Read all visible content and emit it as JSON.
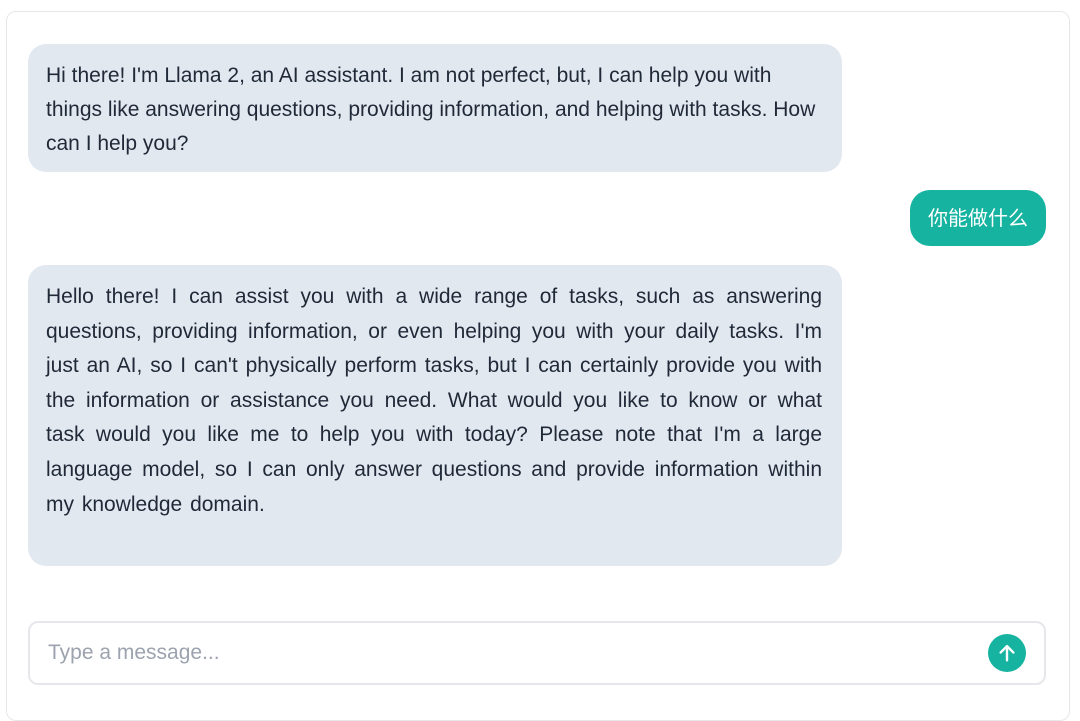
{
  "messages": [
    {
      "role": "assistant",
      "text": "Hi there! I'm Llama 2, an AI assistant. I am not perfect, but, I can help you with things like answering questions, providing information, and helping with tasks. How can I help you?"
    },
    {
      "role": "user",
      "text": "你能做什么"
    },
    {
      "role": "assistant",
      "text": "Hello there! I can assist you with a wide range of tasks, such as answering questions, providing information, or even helping you with your daily tasks. I'm just an AI, so I can't physically perform tasks, but I can certainly provide you with the information or assistance you need. What would you like to know or what task would you like me to help you with today? Please note that I'm a large language model, so I can only answer questions and provide information within my knowledge domain."
    }
  ],
  "composer": {
    "value": "",
    "placeholder": "Type a message...",
    "send_icon": "arrow-up-icon"
  },
  "colors": {
    "assistant_bubble": "#e2e8f0",
    "user_bubble": "#16b3a0",
    "send_button": "#16b3a0",
    "placeholder": "#9ca3af",
    "text": "#1f2937"
  }
}
